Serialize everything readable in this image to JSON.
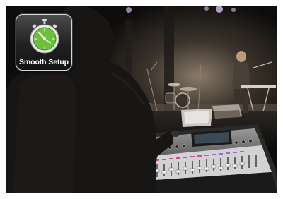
{
  "badge": {
    "label": "Smooth Setup",
    "icon": "stopwatch-icon",
    "accent_color": "#6cc13a",
    "background": "#2a2a2a"
  },
  "scene": {
    "subject": "concert-mixing-console"
  }
}
